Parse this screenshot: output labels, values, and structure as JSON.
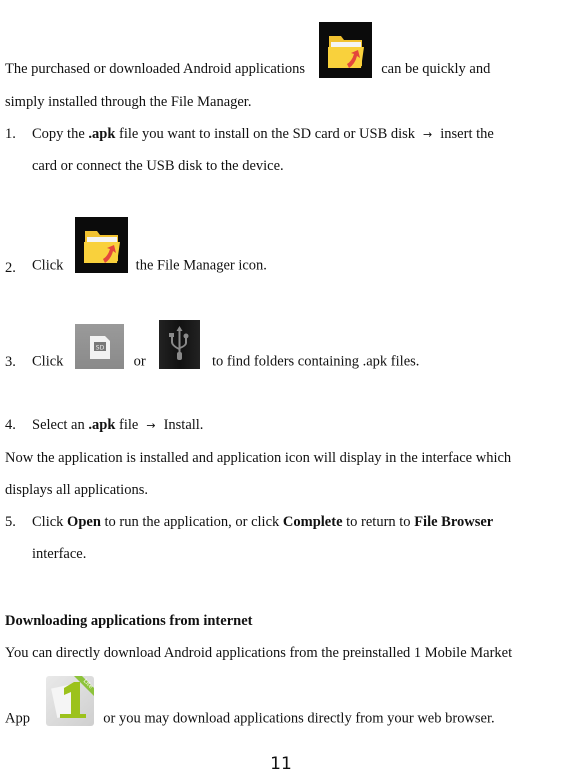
{
  "intro": {
    "before_icon": "The purchased or downloaded Android applications",
    "after_icon": "can be quickly and",
    "line2": "simply installed through the File Manager."
  },
  "steps": [
    {
      "num": "1.",
      "text_a": "Copy the ",
      "bold_a": ".apk",
      "text_b": " file you want to install on the SD card or USB disk",
      "arrow": "→",
      "text_c": "insert the",
      "cont": "card or connect the USB disk to the device."
    },
    {
      "num": "2.",
      "text_a": "Click",
      "text_b": "the File Manager icon."
    },
    {
      "num": "3.",
      "text_a": "Click",
      "or": "or",
      "text_b": "to find folders containing .apk files."
    },
    {
      "num": "4.",
      "text_a": "Select an ",
      "bold_a": ".apk",
      "text_b": " file",
      "arrow": "→",
      "text_c": "Install."
    },
    {
      "num": "5.",
      "text_a": "Click ",
      "bold_a": "Open",
      "text_b": " to run the application, or click ",
      "bold_b": "Complete",
      "text_c": " to return to ",
      "bold_c": "File Browser",
      "cont": "interface."
    }
  ],
  "installed_note": {
    "line1": "Now the application is installed and application icon will display in the interface which",
    "line2": "displays all applications."
  },
  "download_section": {
    "heading": "Downloading applications from internet",
    "line1": "You can directly download Android applications from the preinstalled 1 Mobile Market",
    "app_label": "App",
    "line2": "or you may download applications directly from your web browser."
  },
  "icons": {
    "file_manager": "file-manager-icon",
    "sd_card": "sd-card-icon",
    "usb": "usb-icon",
    "one_mobile_market": "1mobile-market-lite-icon",
    "one_badge": "Lite"
  },
  "page_number": "11"
}
